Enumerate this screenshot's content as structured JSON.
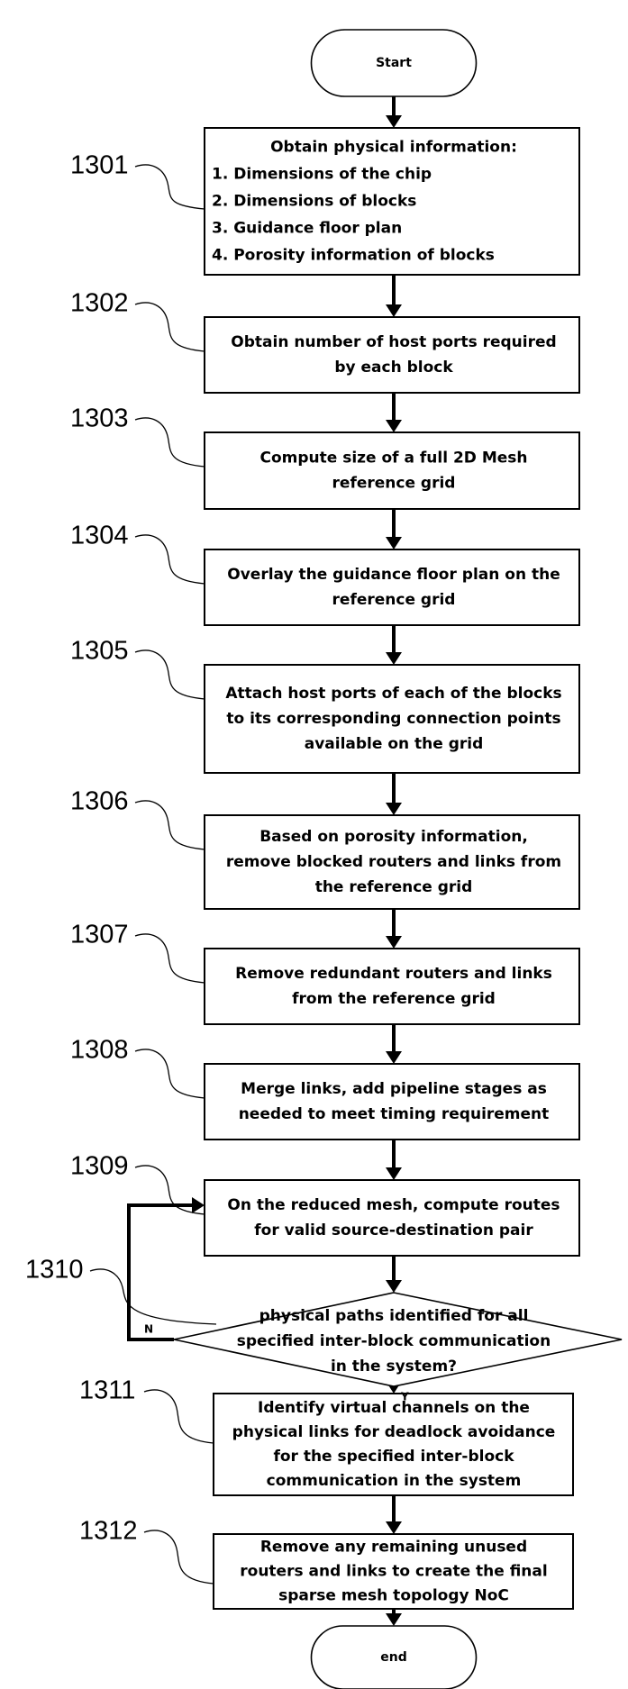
{
  "diagram": {
    "type": "flowchart",
    "start": {
      "label": "Start"
    },
    "end": {
      "label": "end"
    },
    "steps": [
      {
        "ref": "1301",
        "lines": [
          "Obtain physical information:",
          "1. Dimensions of the chip",
          "2. Dimensions of blocks",
          "3. Guidance floor plan",
          "4. Porosity information of blocks"
        ]
      },
      {
        "ref": "1302",
        "lines": [
          "Obtain number of host ports required",
          "by each block"
        ]
      },
      {
        "ref": "1303",
        "lines": [
          "Compute size of a full 2D Mesh",
          "reference grid"
        ]
      },
      {
        "ref": "1304",
        "lines": [
          "Overlay the guidance floor plan on the",
          "reference grid"
        ]
      },
      {
        "ref": "1305",
        "lines": [
          "Attach host ports of each of the blocks",
          "to its corresponding connection points",
          "available on the grid"
        ]
      },
      {
        "ref": "1306",
        "lines": [
          "Based on porosity information,",
          "remove blocked routers and links from",
          "the reference grid"
        ]
      },
      {
        "ref": "1307",
        "lines": [
          "Remove redundant routers and links",
          "from the reference grid"
        ]
      },
      {
        "ref": "1308",
        "lines": [
          "Merge links, add pipeline stages as",
          "needed to meet timing requirement"
        ]
      },
      {
        "ref": "1309",
        "lines": [
          "On the reduced mesh, compute routes",
          "for valid source-destination pair"
        ]
      }
    ],
    "decision": {
      "ref": "1310",
      "lines": [
        "physical paths identified for all",
        "specified inter-block communication",
        "in the system?"
      ],
      "no_label": "N",
      "yes_label": "Y"
    },
    "after_steps": [
      {
        "ref": "1311",
        "lines": [
          "Identify virtual channels on the",
          "physical links for deadlock avoidance",
          "for the specified inter-block",
          "communication in the system"
        ]
      },
      {
        "ref": "1312",
        "lines": [
          "Remove any remaining unused",
          "routers and links to create the final",
          "sparse mesh topology NoC"
        ]
      }
    ]
  }
}
